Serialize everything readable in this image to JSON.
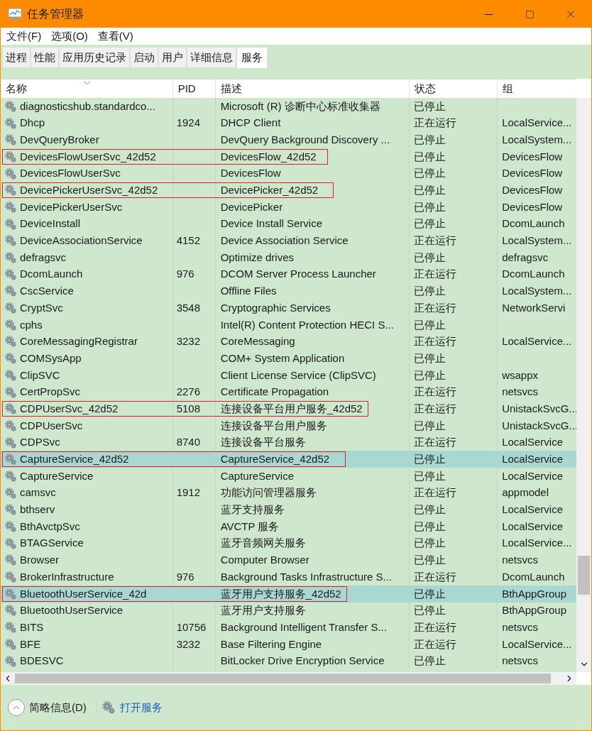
{
  "window": {
    "title": "任务管理器"
  },
  "menu": [
    "文件(F)",
    "选项(O)",
    "查看(V)"
  ],
  "tabs": [
    {
      "label": "进程",
      "selected": false
    },
    {
      "label": "性能",
      "selected": false
    },
    {
      "label": "应用历史记录",
      "selected": false
    },
    {
      "label": "启动",
      "selected": false
    },
    {
      "label": "用户",
      "selected": false
    },
    {
      "label": "详细信息",
      "selected": false
    },
    {
      "label": "服务",
      "selected": true
    }
  ],
  "table": {
    "columns": [
      "名称",
      "PID",
      "描述",
      "状态",
      "组"
    ],
    "rows": [
      {
        "name": "diagnosticshub.standardco...",
        "pid": "",
        "description": "Microsoft (R) 诊断中心标准收集器",
        "status": "已停止",
        "group": "",
        "selected": false,
        "outlined": false
      },
      {
        "name": "Dhcp",
        "pid": "1924",
        "description": "DHCP Client",
        "status": "正在运行",
        "group": "LocalService...",
        "selected": false,
        "outlined": false
      },
      {
        "name": "DevQueryBroker",
        "pid": "",
        "description": "DevQuery Background Discovery ...",
        "status": "已停止",
        "group": "LocalSystem...",
        "selected": false,
        "outlined": false
      },
      {
        "name": "DevicesFlowUserSvc_42d52",
        "pid": "",
        "description": "DevicesFlow_42d52",
        "status": "已停止",
        "group": "DevicesFlow",
        "selected": false,
        "outlined": true
      },
      {
        "name": "DevicesFlowUserSvc",
        "pid": "",
        "description": "DevicesFlow",
        "status": "已停止",
        "group": "DevicesFlow",
        "selected": false,
        "outlined": false
      },
      {
        "name": "DevicePickerUserSvc_42d52",
        "pid": "",
        "description": "DevicePicker_42d52",
        "status": "已停止",
        "group": "DevicesFlow",
        "selected": false,
        "outlined": true
      },
      {
        "name": "DevicePickerUserSvc",
        "pid": "",
        "description": "DevicePicker",
        "status": "已停止",
        "group": "DevicesFlow",
        "selected": false,
        "outlined": false
      },
      {
        "name": "DeviceInstall",
        "pid": "",
        "description": "Device Install Service",
        "status": "已停止",
        "group": "DcomLaunch",
        "selected": false,
        "outlined": false
      },
      {
        "name": "DeviceAssociationService",
        "pid": "4152",
        "description": "Device Association Service",
        "status": "正在运行",
        "group": "LocalSystem...",
        "selected": false,
        "outlined": false
      },
      {
        "name": "defragsvc",
        "pid": "",
        "description": "Optimize drives",
        "status": "已停止",
        "group": "defragsvc",
        "selected": false,
        "outlined": false
      },
      {
        "name": "DcomLaunch",
        "pid": "976",
        "description": "DCOM Server Process Launcher",
        "status": "正在运行",
        "group": "DcomLaunch",
        "selected": false,
        "outlined": false
      },
      {
        "name": "CscService",
        "pid": "",
        "description": "Offline Files",
        "status": "已停止",
        "group": "LocalSystem...",
        "selected": false,
        "outlined": false
      },
      {
        "name": "CryptSvc",
        "pid": "3548",
        "description": "Cryptographic Services",
        "status": "正在运行",
        "group": "NetworkServi",
        "selected": false,
        "outlined": false
      },
      {
        "name": "cphs",
        "pid": "",
        "description": "Intel(R) Content Protection HECI S...",
        "status": "已停止",
        "group": "",
        "selected": false,
        "outlined": false
      },
      {
        "name": "CoreMessagingRegistrar",
        "pid": "3232",
        "description": "CoreMessaging",
        "status": "正在运行",
        "group": "LocalService...",
        "selected": false,
        "outlined": false
      },
      {
        "name": "COMSysApp",
        "pid": "",
        "description": "COM+ System Application",
        "status": "已停止",
        "group": "",
        "selected": false,
        "outlined": false
      },
      {
        "name": "ClipSVC",
        "pid": "",
        "description": "Client License Service (ClipSVC)",
        "status": "已停止",
        "group": "wsappx",
        "selected": false,
        "outlined": false
      },
      {
        "name": "CertPropSvc",
        "pid": "2276",
        "description": "Certificate Propagation",
        "status": "正在运行",
        "group": "netsvcs",
        "selected": false,
        "outlined": false
      },
      {
        "name": "CDPUserSvc_42d52",
        "pid": "5108",
        "description": "连接设备平台用户服务_42d52",
        "status": "正在运行",
        "group": "UnistackSvcG...",
        "selected": false,
        "outlined": true
      },
      {
        "name": "CDPUserSvc",
        "pid": "",
        "description": "连接设备平台用户服务",
        "status": "已停止",
        "group": "UnistackSvcG...",
        "selected": false,
        "outlined": false
      },
      {
        "name": "CDPSvc",
        "pid": "8740",
        "description": "连接设备平台服务",
        "status": "正在运行",
        "group": "LocalService",
        "selected": false,
        "outlined": false
      },
      {
        "name": "CaptureService_42d52",
        "pid": "",
        "description": "CaptureService_42d52",
        "status": "已停止",
        "group": "LocalService",
        "selected": true,
        "outlined": true
      },
      {
        "name": "CaptureService",
        "pid": "",
        "description": "CaptureService",
        "status": "已停止",
        "group": "LocalService",
        "selected": false,
        "outlined": false
      },
      {
        "name": "camsvc",
        "pid": "1912",
        "description": "功能访问管理器服务",
        "status": "正在运行",
        "group": "appmodel",
        "selected": false,
        "outlined": false
      },
      {
        "name": "bthserv",
        "pid": "",
        "description": "蓝牙支持服务",
        "status": "已停止",
        "group": "LocalService",
        "selected": false,
        "outlined": false
      },
      {
        "name": "BthAvctpSvc",
        "pid": "",
        "description": "AVCTP 服务",
        "status": "已停止",
        "group": "LocalService",
        "selected": false,
        "outlined": false
      },
      {
        "name": "BTAGService",
        "pid": "",
        "description": "蓝牙音频网关服务",
        "status": "已停止",
        "group": "LocalService...",
        "selected": false,
        "outlined": false
      },
      {
        "name": "Browser",
        "pid": "",
        "description": "Computer Browser",
        "status": "已停止",
        "group": "netsvcs",
        "selected": false,
        "outlined": false
      },
      {
        "name": "BrokerInfrastructure",
        "pid": "976",
        "description": "Background Tasks Infrastructure S...",
        "status": "正在运行",
        "group": "DcomLaunch",
        "selected": false,
        "outlined": false
      },
      {
        "name": "BluetoothUserService_42d",
        "pid": "",
        "description": "蓝牙用户支持服务_42d52",
        "status": "已停止",
        "group": "BthAppGroup",
        "selected": true,
        "outlined": true
      },
      {
        "name": "BluetoothUserService",
        "pid": "",
        "description": "蓝牙用户支持服务",
        "status": "已停止",
        "group": "BthAppGroup",
        "selected": false,
        "outlined": false
      },
      {
        "name": "BITS",
        "pid": "10756",
        "description": "Background Intelligent Transfer S...",
        "status": "正在运行",
        "group": "netsvcs",
        "selected": false,
        "outlined": false
      },
      {
        "name": "BFE",
        "pid": "3232",
        "description": "Base Filtering Engine",
        "status": "正在运行",
        "group": "LocalService...",
        "selected": false,
        "outlined": false
      },
      {
        "name": "BDESVC",
        "pid": "",
        "description": "BitLocker Drive Encryption Service",
        "status": "已停止",
        "group": "netsvcs",
        "selected": false,
        "outlined": false
      }
    ]
  },
  "footer": {
    "details_toggle": "简略信息(D)",
    "open_services": "打开服务"
  }
}
